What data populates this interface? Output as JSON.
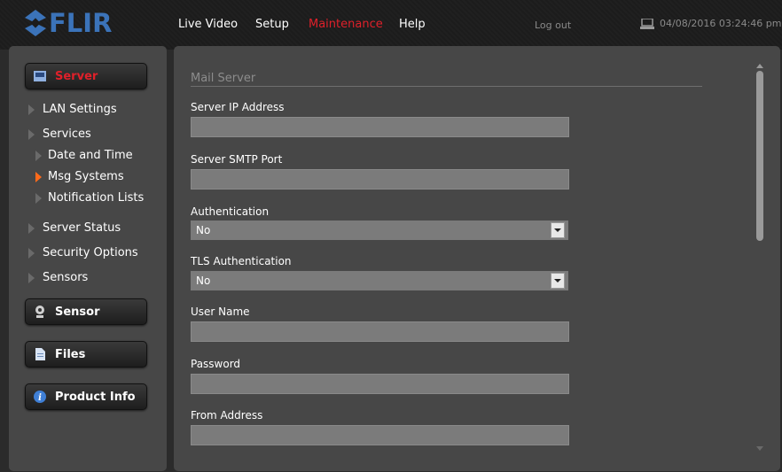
{
  "brand": {
    "logo_text": "FLIR",
    "logo_color": "#3b73b9"
  },
  "nav": {
    "live_video": "Live Video",
    "setup": "Setup",
    "maintenance": "Maintenance",
    "help": "Help",
    "active_color": "#e0202a"
  },
  "header": {
    "logout": "Log out",
    "datetime": "04/08/2016 03:24:46 pm"
  },
  "sidebar": {
    "server_button": "Server",
    "items": {
      "lan": "LAN Settings",
      "services": "Services",
      "date_time": "Date and Time",
      "msg_systems": "Msg Systems",
      "notification_lists": "Notification Lists",
      "server_status": "Server Status",
      "security_options": "Security Options",
      "sensors": "Sensors"
    },
    "sensor_button": "Sensor",
    "files_button": "Files",
    "product_info_button": "Product Info",
    "selected_color": "#ff6a1a"
  },
  "form": {
    "section_title": "Mail Server",
    "server_ip_label": "Server IP Address",
    "server_ip_value": "",
    "smtp_port_label": "Server SMTP Port",
    "smtp_port_value": "",
    "auth_label": "Authentication",
    "auth_value": "No",
    "tls_label": "TLS Authentication",
    "tls_value": "No",
    "username_label": "User Name",
    "username_value": "",
    "password_label": "Password",
    "password_value": "",
    "from_label": "From Address",
    "from_value": ""
  }
}
